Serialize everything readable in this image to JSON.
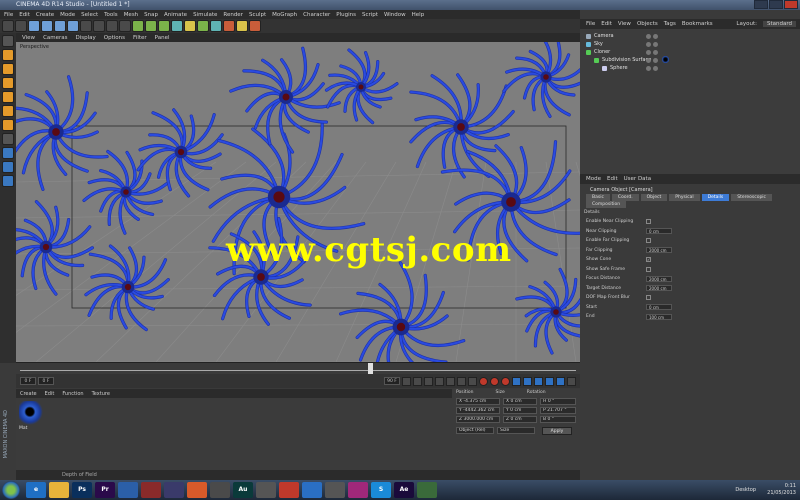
{
  "window": {
    "title": "CINEMA 4D R14 Studio - [Untitled 1 *]"
  },
  "menubar": [
    "File",
    "Edit",
    "Create",
    "Mode",
    "Select",
    "Tools",
    "Mesh",
    "Snap",
    "Animate",
    "Simulate",
    "Render",
    "Sculpt",
    "MoGraph",
    "Character",
    "Plugins",
    "Script",
    "Window",
    "Help"
  ],
  "layout_label": "Layout:",
  "layout_value": "Standard",
  "viewport": {
    "menu": [
      "View",
      "Cameras",
      "Display",
      "Options",
      "Filter",
      "Panel"
    ],
    "label": "Perspective",
    "watermark": "www.cgtsj.com"
  },
  "object_manager": {
    "menu": [
      "File",
      "Edit",
      "View",
      "Objects",
      "Tags",
      "Bookmarks"
    ],
    "objects": [
      {
        "name": "Camera",
        "indent": 0
      },
      {
        "name": "Sky",
        "indent": 0
      },
      {
        "name": "Cloner",
        "indent": 0
      },
      {
        "name": "Subdivision Surface",
        "indent": 1
      },
      {
        "name": "Sphere",
        "indent": 2
      }
    ]
  },
  "attribute_manager": {
    "menu": [
      "Mode",
      "Edit",
      "User Data"
    ],
    "title": "Camera Object [Camera]",
    "tabs": [
      "Basic",
      "Coord.",
      "Object",
      "Physical",
      "Details",
      "Stereoscopic"
    ],
    "tabs_row2": [
      "Composition"
    ],
    "active_tab": "Details",
    "section": "Details",
    "rows": [
      {
        "label": "Enable Near Clipping",
        "value": ""
      },
      {
        "label": "Near Clipping",
        "value": "0 cm"
      },
      {
        "label": "Enable Far Clipping",
        "value": ""
      },
      {
        "label": "Far Clipping",
        "value": "2000 cm"
      },
      {
        "label": "Show Cone",
        "value": "✓"
      },
      {
        "label": "Show Safe Frame",
        "value": ""
      },
      {
        "label": "Focus Distance",
        "value": "2000 cm"
      },
      {
        "label": "Target Distance",
        "value": "2000 cm"
      },
      {
        "label": "DOF Map Front Blur",
        "value": ""
      },
      {
        "label": "Start",
        "value": "0 cm"
      },
      {
        "label": "End",
        "value": "100 cm"
      }
    ]
  },
  "timeline": {
    "start_frame": "0 F",
    "end_frame": "90 F",
    "current_frame": "0 F"
  },
  "material_manager": {
    "menu": [
      "Create",
      "Edit",
      "Function",
      "Texture"
    ],
    "material_name": "Mat"
  },
  "coordinates": {
    "headers": [
      "Position",
      "Size",
      "Rotation"
    ],
    "rows": [
      [
        "X  -4.375 cm",
        "X  0 cm",
        "H  0 °"
      ],
      [
        "Y  -4442.362 cm",
        "Y  0 cm",
        "P  21.707 °"
      ],
      [
        "Z  3000.000 cm",
        "Z  0 cm",
        "B  0 °"
      ]
    ],
    "mode1": "Object (Rel)",
    "mode2": "Size",
    "apply": "Apply"
  },
  "side_label": "MAXON CINEMA 4D",
  "status_text": "Depth of Field",
  "taskbar": {
    "apps": [
      {
        "label": "e",
        "color": "#1f6fc4"
      },
      {
        "label": "",
        "color": "#e8b33a"
      },
      {
        "label": "Ps",
        "color": "#0a2f5c"
      },
      {
        "label": "Pr",
        "color": "#2a0a4a"
      },
      {
        "label": "",
        "color": "#2b5fa8"
      },
      {
        "label": "",
        "color": "#8a2a2a"
      },
      {
        "label": "",
        "color": "#3a3a6a"
      },
      {
        "label": "",
        "color": "#d85a2a"
      },
      {
        "label": "",
        "color": "#4a4a4a"
      },
      {
        "label": "Au",
        "color": "#0a3a3a"
      },
      {
        "label": "",
        "color": "#555"
      },
      {
        "label": "",
        "color": "#c0392b"
      },
      {
        "label": "",
        "color": "#2a6fc4"
      },
      {
        "label": "",
        "color": "#555"
      },
      {
        "label": "",
        "color": "#a0287a"
      },
      {
        "label": "S",
        "color": "#1a8ad8"
      },
      {
        "label": "Ae",
        "color": "#1a0a3a"
      },
      {
        "label": "",
        "color": "#3a6a3a"
      }
    ],
    "desktop_label": "Desktop",
    "time": "0:11",
    "date": "21/05/2013"
  },
  "colors": {
    "accent": "#3d7bd6",
    "viewport_bg": "#7e7e7e",
    "watermark": "#ffff00",
    "creature_blue": "#2a4be0"
  }
}
